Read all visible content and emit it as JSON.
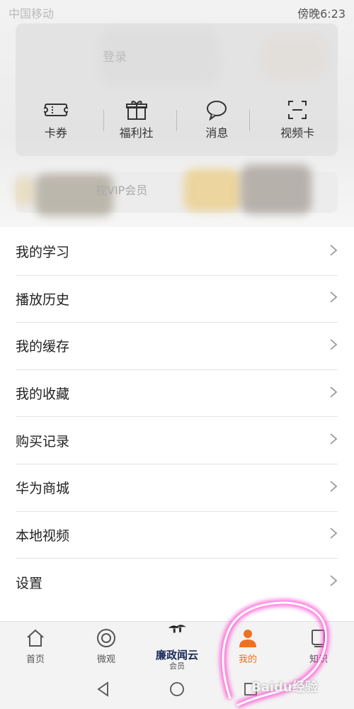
{
  "status_bar": {
    "carrier": "中国移动",
    "time": "傍晚6:23"
  },
  "login": {
    "text": "登录"
  },
  "card_icons": [
    {
      "label": "卡券",
      "icon": "ticket-icon"
    },
    {
      "label": "福利社",
      "icon": "gift-icon"
    },
    {
      "label": "消息",
      "icon": "message-icon"
    },
    {
      "label": "视频卡",
      "icon": "scan-icon"
    }
  ],
  "vip_banner": {
    "text": "视VIP会员"
  },
  "menu": [
    {
      "label": "我的学习"
    },
    {
      "label": "播放历史"
    },
    {
      "label": "我的缓存"
    },
    {
      "label": "我的收藏"
    },
    {
      "label": "购买记录"
    },
    {
      "label": "华为商城"
    },
    {
      "label": "本地视频"
    },
    {
      "label": "设置"
    }
  ],
  "tabbar": [
    {
      "label": "首页",
      "icon": "home-icon"
    },
    {
      "label": "微观",
      "icon": "circle-icon"
    },
    {
      "label": "会员",
      "icon": "member-logo",
      "logo_text": "廉政闻云"
    },
    {
      "label": "我的",
      "icon": "person-icon",
      "active": true
    },
    {
      "label": "知识",
      "icon": "book-icon"
    }
  ],
  "watermark": "Baidu经验",
  "colors": {
    "accent": "#f07022",
    "pink_ring": "#ff3fd0"
  }
}
